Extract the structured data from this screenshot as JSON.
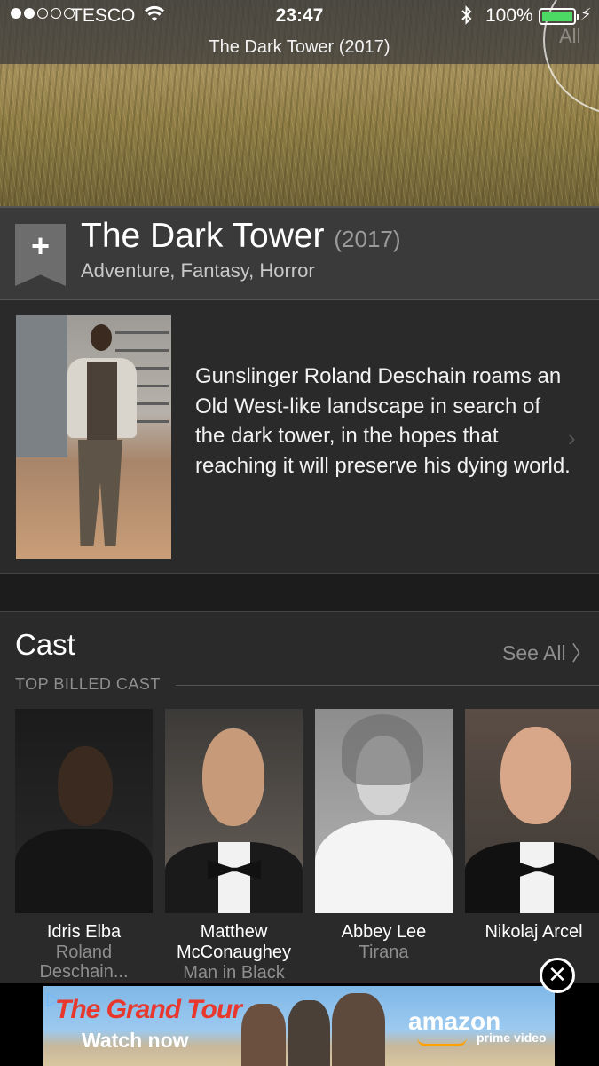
{
  "status_bar": {
    "carrier": "TESCO",
    "time": "23:47",
    "battery_percent": "100%",
    "signal_bars_filled": 2,
    "signal_bars_total": 5
  },
  "nav": {
    "title": "The Dark Tower (2017)"
  },
  "hero": {
    "overlay_text": "All"
  },
  "movie": {
    "title": "The Dark Tower",
    "year": "(2017)",
    "genres": "Adventure, Fantasy, Horror",
    "watchlist_icon": "plus-bookmark-icon",
    "synopsis": "Gunslinger Roland Deschain roams an Old West-like landscape in search of the dark tower, in the hopes that reaching it will preserve his dying world."
  },
  "cast": {
    "heading": "Cast",
    "see_all": "See All 〉",
    "subheading": "TOP BILLED CAST",
    "members": [
      {
        "name": "Idris Elba",
        "role": "Roland Deschain..."
      },
      {
        "name": "Matthew McConaughey",
        "role": "Man in Black"
      },
      {
        "name": "Abbey Lee",
        "role": "Tirana"
      },
      {
        "name": "Nikolaj Arcel",
        "role": ""
      }
    ]
  },
  "ad": {
    "title": "The Grand Tour",
    "cta": "Watch now",
    "brand": "amazon",
    "brand_sub": "prime video",
    "close_icon": "close-circle-icon"
  },
  "colors": {
    "battery_green": "#4cd964",
    "background": "#1f1f1f",
    "panel": "#2a2a2a",
    "muted_text": "#8e8e8e",
    "ad_red": "#e8382d"
  }
}
